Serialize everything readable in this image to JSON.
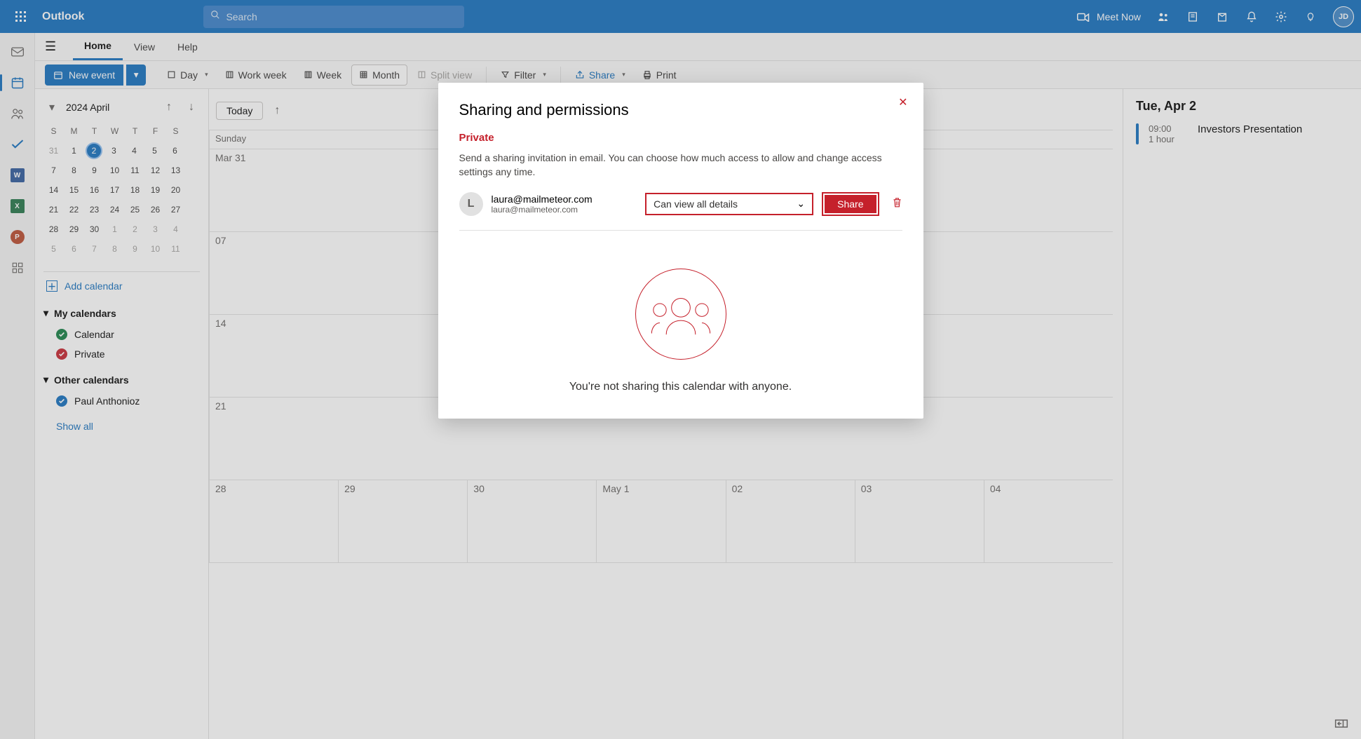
{
  "app": {
    "name": "Outlook"
  },
  "search": {
    "placeholder": "Search"
  },
  "meet_now": "Meet Now",
  "avatar_initials": "JD",
  "tabs": {
    "home": "Home",
    "view": "View",
    "help": "Help"
  },
  "toolbar": {
    "new_event": "New event",
    "day": "Day",
    "work_week": "Work week",
    "week": "Week",
    "month": "Month",
    "split_view": "Split view",
    "filter": "Filter",
    "share": "Share",
    "print": "Print"
  },
  "mini_cal": {
    "label": "2024 April",
    "dow": [
      "S",
      "M",
      "T",
      "W",
      "T",
      "F",
      "S"
    ],
    "rows": [
      [
        "31",
        "1",
        "2",
        "3",
        "4",
        "5",
        "6"
      ],
      [
        "7",
        "8",
        "9",
        "10",
        "11",
        "12",
        "13"
      ],
      [
        "14",
        "15",
        "16",
        "17",
        "18",
        "19",
        "20"
      ],
      [
        "21",
        "22",
        "23",
        "24",
        "25",
        "26",
        "27"
      ],
      [
        "28",
        "29",
        "30",
        "1",
        "2",
        "3",
        "4"
      ],
      [
        "5",
        "6",
        "7",
        "8",
        "9",
        "10",
        "11"
      ]
    ]
  },
  "add_calendar": "Add calendar",
  "sections": {
    "my": "My calendars",
    "calendar": "Calendar",
    "private": "Private",
    "other": "Other calendars",
    "paul": "Paul Anthonioz",
    "show_all": "Show all"
  },
  "grid": {
    "today_btn": "Today",
    "sunday": "Sunday",
    "labels": {
      "mar31": "Mar 31",
      "d07": "07",
      "d14": "14",
      "d21": "21",
      "d28": "28",
      "d29": "29",
      "d30": "30",
      "may1": "May 1",
      "d02": "02",
      "d03": "03",
      "d04": "04"
    }
  },
  "agenda": {
    "heading": "Tue, Apr 2",
    "event_time": "09:00",
    "event_dur": "1 hour",
    "event_title": "Investors Presentation"
  },
  "modal": {
    "title": "Sharing and permissions",
    "subtitle": "Private",
    "desc": "Send a sharing invitation in email. You can choose how much access to allow and change access settings any time.",
    "avatar": "L",
    "email_display": "laura@mailmeteor.com",
    "email_sub": "laura@mailmeteor.com",
    "perm": "Can view all details",
    "share_btn": "Share",
    "empty": "You're not sharing this calendar with anyone."
  }
}
